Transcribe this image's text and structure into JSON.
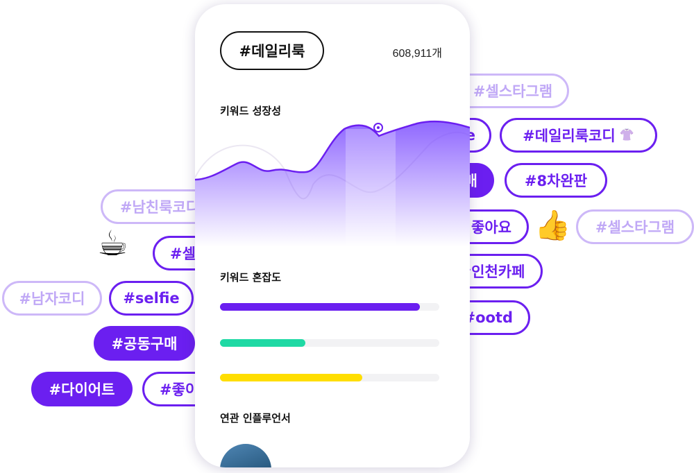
{
  "header": {
    "hashtag": "#데일리룩",
    "post_count": "608,911개"
  },
  "sections": {
    "growth_title": "키워드 성장성",
    "congestion_title": "키워드 혼잡도",
    "influencers_title": "연관 인플루언서"
  },
  "congestion_bars": [
    {
      "fraction": 0.91,
      "color": "#6b1ff0"
    },
    {
      "fraction": 0.39,
      "color": "#1fd9a4"
    },
    {
      "fraction": 0.65,
      "color": "#ffde00"
    }
  ],
  "tags": {
    "left": {
      "namchinlook": "#남친룩코디",
      "sel_partial": "#셀",
      "namjacodi": "#남자코디",
      "selfie": "#selfie",
      "gongdong": "#공동구매",
      "diet": "#다이어트",
      "joh_partial": "#좋이"
    },
    "right": {
      "selstagram_top": "#셀스타그램",
      "e_partial": "e",
      "dailylookcodi": "#데일리룩코디",
      "mae_partial": "매",
      "eight_complete": "#8차완판",
      "joayo_partial": "좋아요",
      "selstagram_side": "#셀스타그램",
      "incheon_cafe": "#인천카페",
      "ootd": "#ootd"
    }
  },
  "emojis": {
    "coffee": "☕",
    "thumbs_up": "👍",
    "shirt": "👚"
  }
}
